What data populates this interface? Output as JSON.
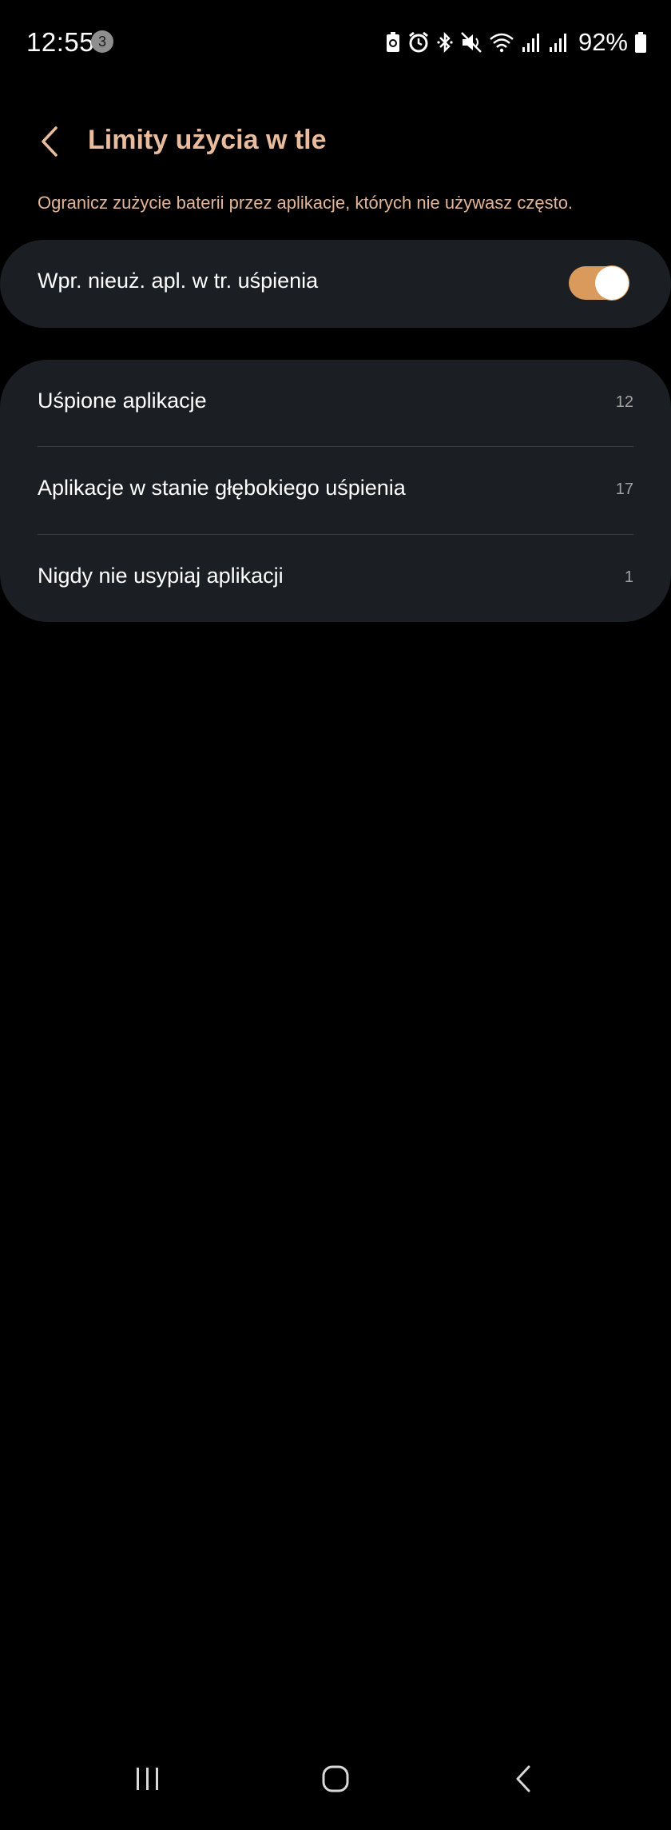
{
  "status_bar": {
    "time": "12:55",
    "notification_count": "3",
    "battery": "92%",
    "icons": [
      "battery-saver-icon",
      "alarm-icon",
      "bluetooth-icon",
      "mute-icon",
      "wifi-icon",
      "signal-icon",
      "signal-icon",
      "battery-icon"
    ]
  },
  "header": {
    "title": "Limity użycia w tle",
    "back_icon": "chevron-left-icon"
  },
  "description": "Ogranicz zużycie baterii przez aplikacje, których nie używasz często.",
  "toggle_setting": {
    "label": "Wpr. nieuż. apl. w tr. uśpienia",
    "enabled": true
  },
  "list": {
    "items": [
      {
        "label": "Uśpione aplikacje",
        "count": "12"
      },
      {
        "label": "Aplikacje w stanie głębokiego uśpienia",
        "count": "17"
      },
      {
        "label": "Nigdy nie usypiaj aplikacji",
        "count": "1"
      }
    ]
  },
  "nav_bar": {
    "buttons": [
      "recents-icon",
      "home-icon",
      "back-icon"
    ]
  },
  "colors": {
    "accent": "#e9bc9d",
    "toggle_on": "#d99a5c",
    "card_bg": "#1b1e22",
    "background": "#000000"
  }
}
